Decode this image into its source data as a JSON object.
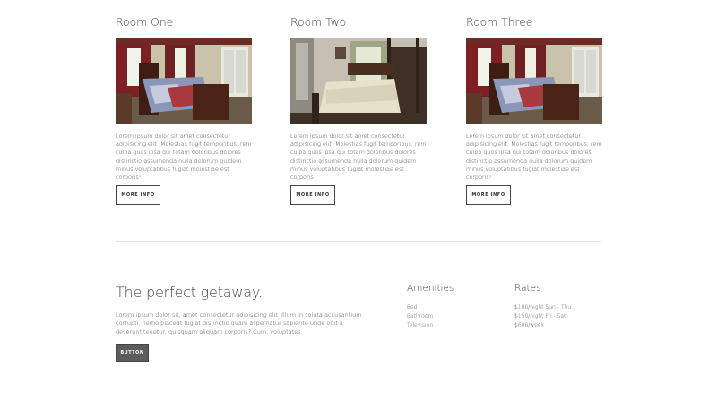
{
  "rooms": [
    {
      "title": "Room One",
      "description": "Lorem ipsum dolor sit amet consectetur adipisicing elit. Molestias fugit temporibus, rem culpa quos ipsa qui totam doloribus dolores distinctio assumenda nulla dolorum quidem minus voluptatibus fugiat molestiae est corporis!",
      "button_label": "MORE INFO",
      "photo_icon": "bedroom-photo-quilt"
    },
    {
      "title": "Room Two",
      "description": "Lorem ipsum dolor sit amet consectetur adipisicing elit. Molestias fugit temporibus, rem culpa quos ipsa qui totam doloribus dolores distinctio assumenda nulla dolorum quidem minus voluptatibus fugiat molestiae est corporis!",
      "button_label": "MORE INFO",
      "photo_icon": "bedroom-photo-four-poster"
    },
    {
      "title": "Room Three",
      "description": "Lorem ipsum dolor sit amet consectetur adipisicing elit. Molestias fugit temporibus, rem culpa quos ipsa qui totam doloribus dolores distinctio assumenda nulla dolorum quidem minus voluptatibus fugiat molestiae est corporis!",
      "button_label": "MORE INFO",
      "photo_icon": "bedroom-photo-quilt"
    }
  ],
  "getaway": {
    "title": "The perfect getaway.",
    "description": "Lorem ipsum dolor sit, amet consectetur adipisicing elit. Illum in soluta accusantium corrupti, nemo placeat fugiat distinctio quam aspernatur sapiente unde odit a deserunt tenetur, quisquam aliquam corporis? Cum, voluptates.",
    "button_label": "BUTTON"
  },
  "amenities": {
    "title": "Amenities",
    "items": [
      "Bed",
      "Bathroom",
      "Television"
    ]
  },
  "rates": {
    "title": "Rates",
    "items": [
      "$100/night Sun - Thu",
      "$150/night Fri - Sat",
      "$600/week"
    ]
  },
  "colors": {
    "text": "#444444",
    "divider": "#e6e6e6",
    "dark_button": "#5c5c5c"
  }
}
